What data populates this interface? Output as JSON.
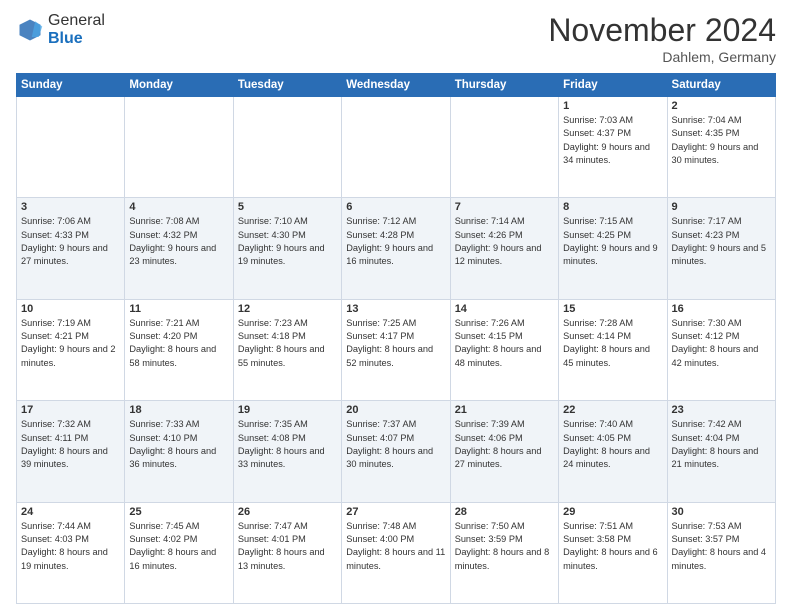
{
  "header": {
    "logo_general": "General",
    "logo_blue": "Blue",
    "month_title": "November 2024",
    "location": "Dahlem, Germany"
  },
  "weekdays": [
    "Sunday",
    "Monday",
    "Tuesday",
    "Wednesday",
    "Thursday",
    "Friday",
    "Saturday"
  ],
  "rows": [
    [
      {
        "day": "",
        "info": ""
      },
      {
        "day": "",
        "info": ""
      },
      {
        "day": "",
        "info": ""
      },
      {
        "day": "",
        "info": ""
      },
      {
        "day": "",
        "info": ""
      },
      {
        "day": "1",
        "info": "Sunrise: 7:03 AM\nSunset: 4:37 PM\nDaylight: 9 hours and 34 minutes."
      },
      {
        "day": "2",
        "info": "Sunrise: 7:04 AM\nSunset: 4:35 PM\nDaylight: 9 hours and 30 minutes."
      }
    ],
    [
      {
        "day": "3",
        "info": "Sunrise: 7:06 AM\nSunset: 4:33 PM\nDaylight: 9 hours and 27 minutes."
      },
      {
        "day": "4",
        "info": "Sunrise: 7:08 AM\nSunset: 4:32 PM\nDaylight: 9 hours and 23 minutes."
      },
      {
        "day": "5",
        "info": "Sunrise: 7:10 AM\nSunset: 4:30 PM\nDaylight: 9 hours and 19 minutes."
      },
      {
        "day": "6",
        "info": "Sunrise: 7:12 AM\nSunset: 4:28 PM\nDaylight: 9 hours and 16 minutes."
      },
      {
        "day": "7",
        "info": "Sunrise: 7:14 AM\nSunset: 4:26 PM\nDaylight: 9 hours and 12 minutes."
      },
      {
        "day": "8",
        "info": "Sunrise: 7:15 AM\nSunset: 4:25 PM\nDaylight: 9 hours and 9 minutes."
      },
      {
        "day": "9",
        "info": "Sunrise: 7:17 AM\nSunset: 4:23 PM\nDaylight: 9 hours and 5 minutes."
      }
    ],
    [
      {
        "day": "10",
        "info": "Sunrise: 7:19 AM\nSunset: 4:21 PM\nDaylight: 9 hours and 2 minutes."
      },
      {
        "day": "11",
        "info": "Sunrise: 7:21 AM\nSunset: 4:20 PM\nDaylight: 8 hours and 58 minutes."
      },
      {
        "day": "12",
        "info": "Sunrise: 7:23 AM\nSunset: 4:18 PM\nDaylight: 8 hours and 55 minutes."
      },
      {
        "day": "13",
        "info": "Sunrise: 7:25 AM\nSunset: 4:17 PM\nDaylight: 8 hours and 52 minutes."
      },
      {
        "day": "14",
        "info": "Sunrise: 7:26 AM\nSunset: 4:15 PM\nDaylight: 8 hours and 48 minutes."
      },
      {
        "day": "15",
        "info": "Sunrise: 7:28 AM\nSunset: 4:14 PM\nDaylight: 8 hours and 45 minutes."
      },
      {
        "day": "16",
        "info": "Sunrise: 7:30 AM\nSunset: 4:12 PM\nDaylight: 8 hours and 42 minutes."
      }
    ],
    [
      {
        "day": "17",
        "info": "Sunrise: 7:32 AM\nSunset: 4:11 PM\nDaylight: 8 hours and 39 minutes."
      },
      {
        "day": "18",
        "info": "Sunrise: 7:33 AM\nSunset: 4:10 PM\nDaylight: 8 hours and 36 minutes."
      },
      {
        "day": "19",
        "info": "Sunrise: 7:35 AM\nSunset: 4:08 PM\nDaylight: 8 hours and 33 minutes."
      },
      {
        "day": "20",
        "info": "Sunrise: 7:37 AM\nSunset: 4:07 PM\nDaylight: 8 hours and 30 minutes."
      },
      {
        "day": "21",
        "info": "Sunrise: 7:39 AM\nSunset: 4:06 PM\nDaylight: 8 hours and 27 minutes."
      },
      {
        "day": "22",
        "info": "Sunrise: 7:40 AM\nSunset: 4:05 PM\nDaylight: 8 hours and 24 minutes."
      },
      {
        "day": "23",
        "info": "Sunrise: 7:42 AM\nSunset: 4:04 PM\nDaylight: 8 hours and 21 minutes."
      }
    ],
    [
      {
        "day": "24",
        "info": "Sunrise: 7:44 AM\nSunset: 4:03 PM\nDaylight: 8 hours and 19 minutes."
      },
      {
        "day": "25",
        "info": "Sunrise: 7:45 AM\nSunset: 4:02 PM\nDaylight: 8 hours and 16 minutes."
      },
      {
        "day": "26",
        "info": "Sunrise: 7:47 AM\nSunset: 4:01 PM\nDaylight: 8 hours and 13 minutes."
      },
      {
        "day": "27",
        "info": "Sunrise: 7:48 AM\nSunset: 4:00 PM\nDaylight: 8 hours and 11 minutes."
      },
      {
        "day": "28",
        "info": "Sunrise: 7:50 AM\nSunset: 3:59 PM\nDaylight: 8 hours and 8 minutes."
      },
      {
        "day": "29",
        "info": "Sunrise: 7:51 AM\nSunset: 3:58 PM\nDaylight: 8 hours and 6 minutes."
      },
      {
        "day": "30",
        "info": "Sunrise: 7:53 AM\nSunset: 3:57 PM\nDaylight: 8 hours and 4 minutes."
      }
    ]
  ]
}
